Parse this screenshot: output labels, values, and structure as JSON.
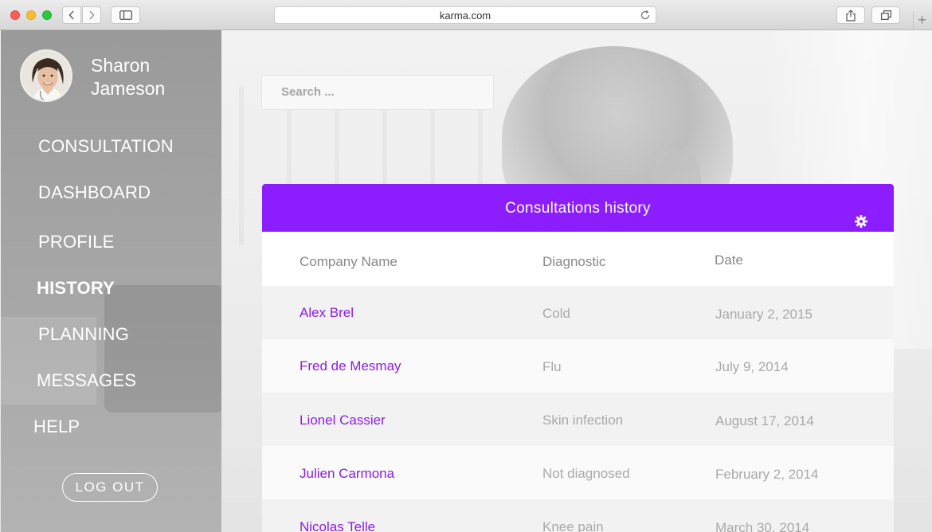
{
  "browser": {
    "url": "karma.com",
    "new_tab_label": "+"
  },
  "user": {
    "first_name": "Sharon",
    "last_name": "Jameson"
  },
  "nav": {
    "items": [
      {
        "label": "CONSULTATION",
        "active": false
      },
      {
        "label": "DASHBOARD",
        "active": false
      },
      {
        "label": "PROFILE",
        "active": false
      },
      {
        "label": "HISTORY",
        "active": true
      },
      {
        "label": "PLANNING",
        "active": false
      },
      {
        "label": "MESSAGES",
        "active": false
      },
      {
        "label": "HELP",
        "active": false
      }
    ],
    "logout_label": "LOG OUT"
  },
  "search": {
    "placeholder": "Search ..."
  },
  "panel": {
    "title": "Consultations history",
    "columns": [
      "Company Name",
      "Diagnostic",
      "Date"
    ],
    "rows": [
      {
        "name": "Alex Brel",
        "diagnostic": "Cold",
        "date": "January 2, 2015"
      },
      {
        "name": "Fred de Mesmay",
        "diagnostic": "Flu",
        "date": "July 9, 2014"
      },
      {
        "name": "Lionel Cassier",
        "diagnostic": "Skin infection",
        "date": "August 17, 2014"
      },
      {
        "name": "Julien Carmona",
        "diagnostic": "Not diagnosed",
        "date": "February 2, 2014"
      },
      {
        "name": "Nicolas Telle",
        "diagnostic": "Knee pain",
        "date": "March 30, 2014"
      }
    ]
  },
  "colors": {
    "accent": "#8c1dff",
    "link": "#8a1fe0"
  }
}
